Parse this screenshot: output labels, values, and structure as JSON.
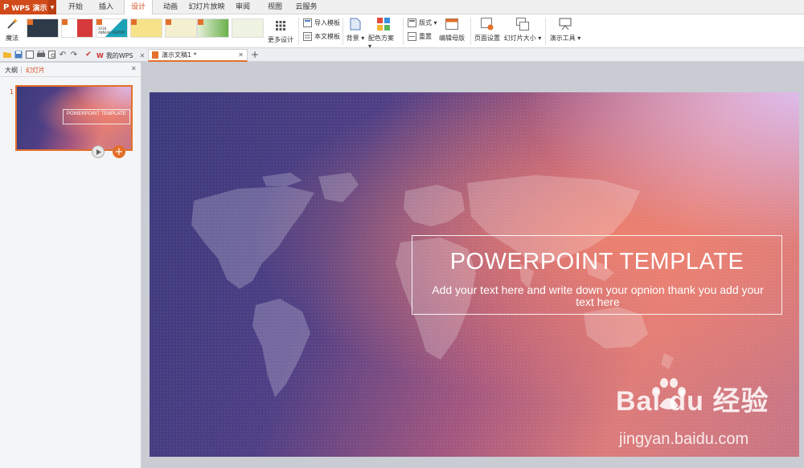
{
  "app": {
    "name": "WPS 演示",
    "logo": "P"
  },
  "menu": [
    "开始",
    "插入",
    "设计",
    "动画",
    "幻灯片放映",
    "审阅",
    "视图",
    "云服务"
  ],
  "ribbon": {
    "magic": "魔法",
    "more_design": "更多设计",
    "import_template": "导入模板",
    "text_template": "本文模板",
    "background": "背景",
    "color_scheme": "配色方案",
    "layout": "版式",
    "reset": "重置",
    "edit_master": "编辑母版",
    "page_setup": "页面设置",
    "slide_size": "幻灯片大小",
    "presentation_tools": "演示工具",
    "template_thumb_text": "2018\nANNUAL REPORT"
  },
  "tabs": {
    "home": "我的WPS",
    "document": "演示文稿1 *",
    "add": "+"
  },
  "left_panel": {
    "outline": "大纲",
    "slides": "幻灯片",
    "slide_number": "1",
    "thumb_title": "POWERPOINT TEMPLATE"
  },
  "slide": {
    "title": "POWERPOINT TEMPLATE",
    "subtitle": "Add your text here and write down your opnion thank you add your text here"
  },
  "watermark": {
    "logo": "Bai du 经验",
    "url": "jingyan.baidu.com"
  },
  "colors": {
    "accent": "#d04a1a",
    "tab_active": "#e3702a"
  }
}
